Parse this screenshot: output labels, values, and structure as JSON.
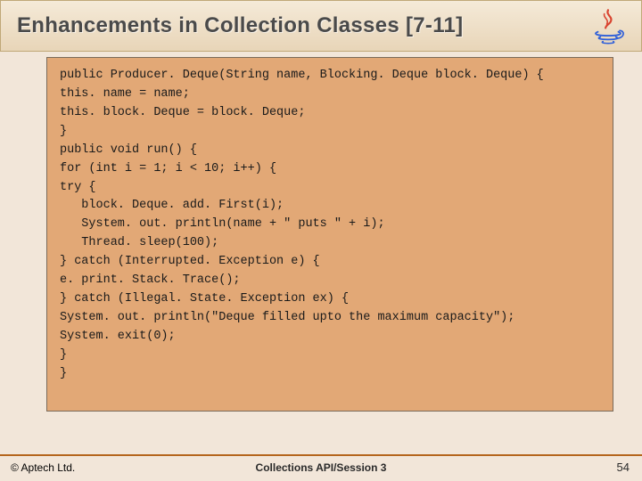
{
  "header": {
    "title": "Enhancements in Collection Classes [7-11]"
  },
  "code": {
    "lines": [
      "public Producer. Deque(String name, Blocking. Deque block. Deque) {",
      "this. name = name;",
      "this. block. Deque = block. Deque;",
      "}",
      "public void run() {",
      "for (int i = 1; i < 10; i++) {",
      "try {",
      "   block. Deque. add. First(i);",
      "   System. out. println(name + \" puts \" + i);",
      "   Thread. sleep(100);",
      "} catch (Interrupted. Exception e) {",
      "e. print. Stack. Trace();",
      "} catch (Illegal. State. Exception ex) {",
      "System. out. println(\"Deque filled upto the maximum capacity\");",
      "System. exit(0);",
      "}",
      "}"
    ]
  },
  "footer": {
    "copyright": "© Aptech Ltd.",
    "session": "Collections API/Session 3",
    "page": "54"
  },
  "icons": {
    "java": "java-logo"
  }
}
